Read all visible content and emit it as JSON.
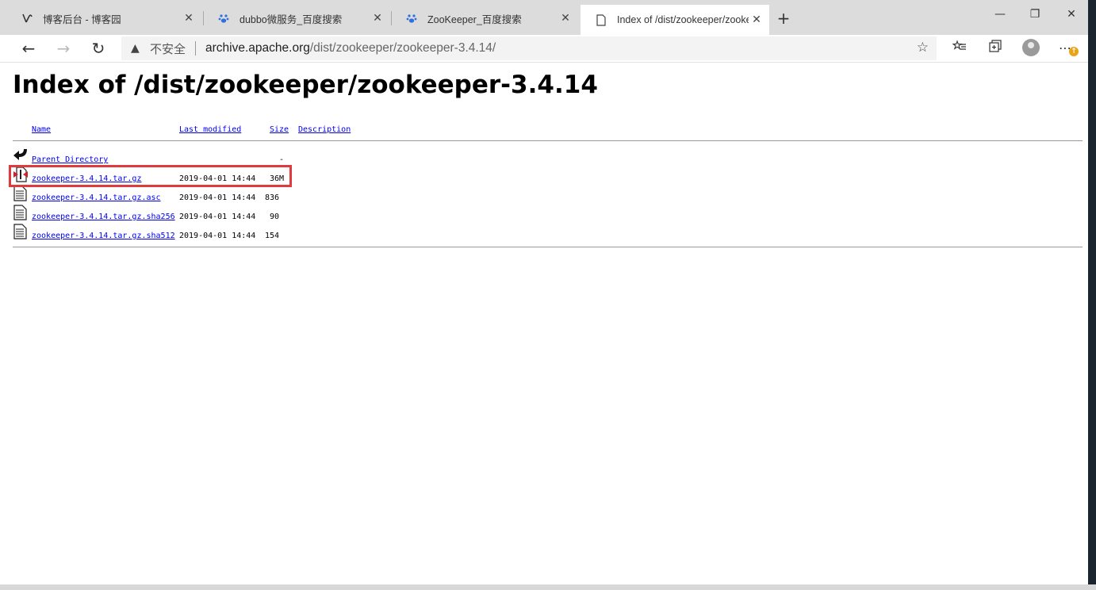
{
  "browser": {
    "tabs": [
      {
        "label": "博客后台 - 博客园",
        "icon": "cnblogs-icon",
        "active": false
      },
      {
        "label": "dubbo微服务_百度搜索",
        "icon": "baidu-paw-icon",
        "active": false
      },
      {
        "label": "ZooKeeper_百度搜索",
        "icon": "baidu-paw-icon",
        "active": false
      },
      {
        "label": "Index of /dist/zookeeper/zookee",
        "icon": "page-icon",
        "active": true
      }
    ],
    "security_label": "不安全",
    "url_host": "archive.apache.org",
    "url_path": "/dist/zookeeper/zookeeper-3.4.14/"
  },
  "page": {
    "title": "Index of /dist/zookeeper/zookeeper-3.4.14",
    "columns": {
      "name": "Name",
      "modified": "Last modified",
      "size": "Size",
      "description": "Description"
    },
    "parent": {
      "name": "Parent Directory",
      "size": "-"
    },
    "files": [
      {
        "name": "zookeeper-3.4.14.tar.gz",
        "modified": "2019-04-01 14:44",
        "size": "36M",
        "icon": "compressed-file-icon",
        "highlighted": true
      },
      {
        "name": "zookeeper-3.4.14.tar.gz.asc",
        "modified": "2019-04-01 14:44",
        "size": "836",
        "icon": "text-file-icon"
      },
      {
        "name": "zookeeper-3.4.14.tar.gz.sha256",
        "modified": "2019-04-01 14:44",
        "size": "90",
        "icon": "text-file-icon"
      },
      {
        "name": "zookeeper-3.4.14.tar.gz.sha512",
        "modified": "2019-04-01 14:44",
        "size": "154",
        "icon": "text-file-icon"
      }
    ]
  },
  "colors": {
    "highlight_box": "#e0393e",
    "link": "#0000ee"
  }
}
